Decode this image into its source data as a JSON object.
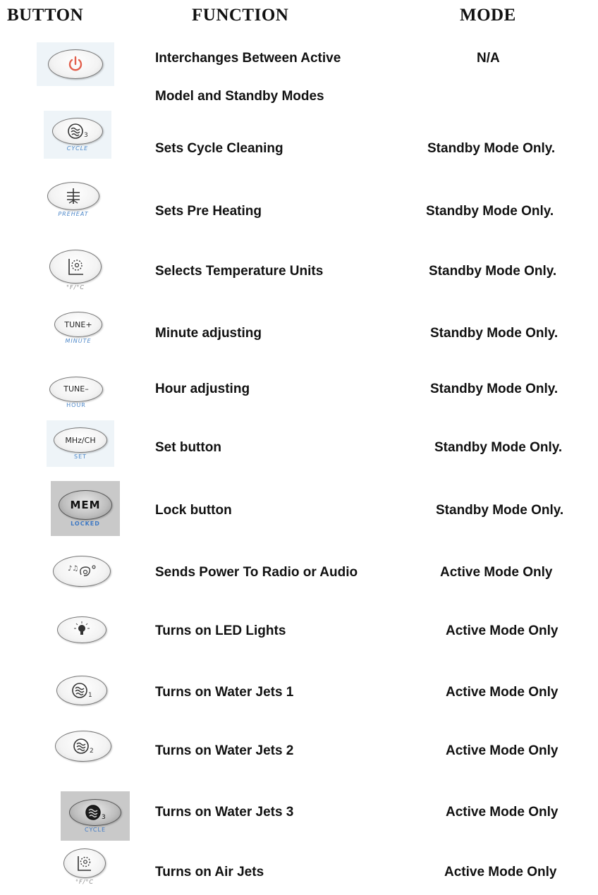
{
  "header": {
    "button": "BUTTON",
    "function": "FUNCTION",
    "mode": "MODE"
  },
  "rows": [
    {
      "icon": "power-icon",
      "function_line1": "Interchanges Between Active",
      "function_line2": "Model and Standby Modes",
      "mode": "N/A"
    },
    {
      "icon": "jets-3-icon",
      "sub": "CYCLE",
      "function": "Sets Cycle Cleaning",
      "mode": "Standby Mode Only."
    },
    {
      "icon": "heater-icon",
      "sub": "PREHEAT",
      "function": "Sets Pre Heating",
      "mode": "Standby Mode Only."
    },
    {
      "icon": "air-jet-icon",
      "sub": "°F/°C",
      "function": "Selects Temperature Units",
      "mode": "Standby Mode Only."
    },
    {
      "icon": "tune-plus-icon",
      "tag": "TUNE+",
      "sub": "MINUTE",
      "function": "Minute adjusting",
      "mode": "Standby Mode Only."
    },
    {
      "icon": "tune-minus-icon",
      "tag": "TUNE–",
      "sub": "HOUR",
      "function": "Hour adjusting",
      "mode": "Standby Mode Only."
    },
    {
      "icon": "mhz-ch-icon",
      "tag": "MHz/CH",
      "sub": "SET",
      "function": "Set button",
      "mode": "Standby Mode Only."
    },
    {
      "icon": "mem-icon",
      "tag": "MEM",
      "sub": "LOCKED",
      "function": "Lock button",
      "mode": "Standby Mode Only."
    },
    {
      "icon": "audio-icon",
      "function": "Sends Power To Radio or Audio",
      "mode": "Active Mode Only"
    },
    {
      "icon": "light-bulb-icon",
      "function": "Turns on LED Lights",
      "mode": "Active Mode Only"
    },
    {
      "icon": "jets-1-icon",
      "function": "Turns on Water Jets 1",
      "mode": "Active Mode Only"
    },
    {
      "icon": "jets-2-icon",
      "function": "Turns on Water Jets 2",
      "mode": "Active Mode Only"
    },
    {
      "icon": "jets-3-icon",
      "sub": "CYCLE",
      "function": "Turns on Water Jets 3",
      "mode": "Active Mode Only"
    },
    {
      "icon": "air-jet-icon",
      "sub": "°F/°C",
      "function": "Turns on Air Jets",
      "mode": "Active Mode Only"
    }
  ]
}
